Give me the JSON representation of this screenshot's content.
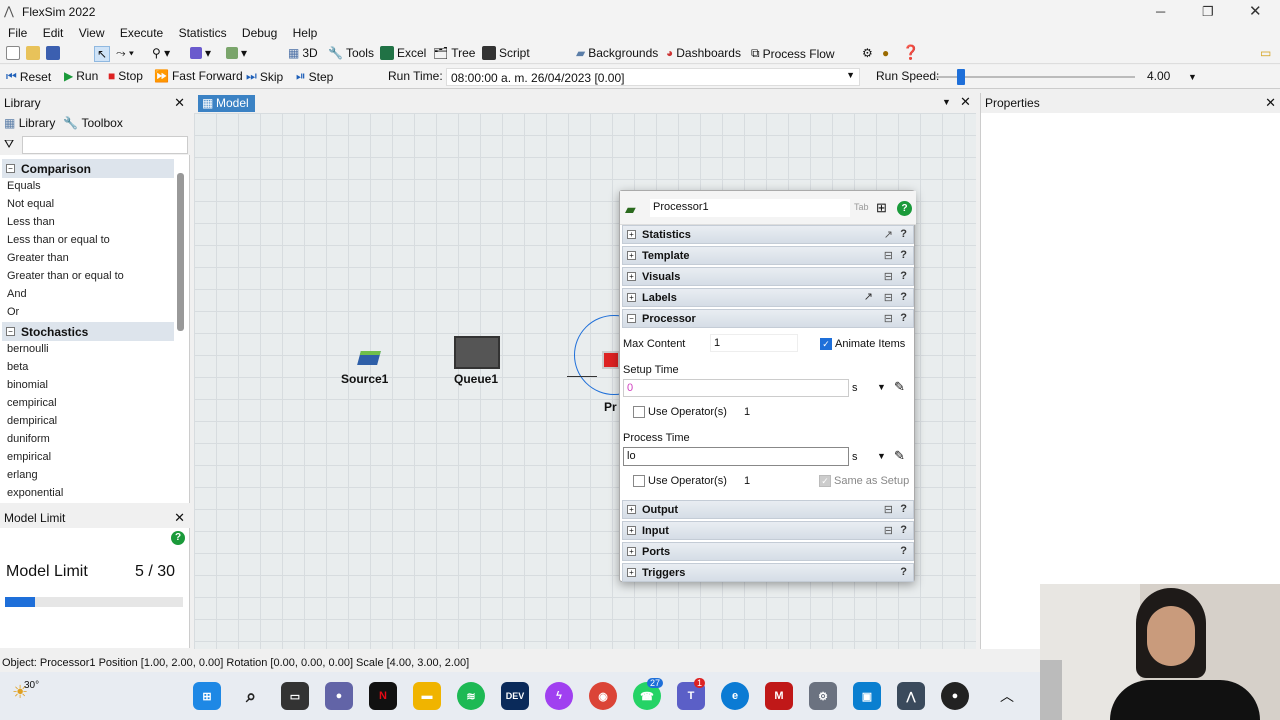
{
  "window": {
    "title": "FlexSim 2022"
  },
  "menu": [
    "File",
    "Edit",
    "View",
    "Execute",
    "Statistics",
    "Debug",
    "Help"
  ],
  "toolbar1": {
    "3d": "3D",
    "tools": "Tools",
    "excel": "Excel",
    "tree": "Tree",
    "script": "Script",
    "backgrounds": "Backgrounds",
    "dashboards": "Dashboards",
    "process_flow": "Process Flow"
  },
  "toolbar2": {
    "reset": "Reset",
    "run": "Run",
    "stop": "Stop",
    "fast_forward": "Fast Forward",
    "skip": "Skip",
    "step": "Step",
    "run_time_label": "Run Time:",
    "run_time_value": "08:00:00 a. m.  26/04/2023  [0.00]",
    "run_speed_label": "Run Speed:",
    "run_speed_value": "4.00"
  },
  "library": {
    "title": "Library",
    "tab_library": "Library",
    "tab_toolbox": "Toolbox",
    "sections": [
      {
        "name": "Comparison",
        "items": [
          "Equals",
          "Not equal",
          "Less than",
          "Less than or equal to",
          "Greater than",
          "Greater than or equal to",
          "And",
          "Or"
        ]
      },
      {
        "name": "Stochastics",
        "items": [
          "bernoulli",
          "beta",
          "binomial",
          "cempirical",
          "dempirical",
          "duniform",
          "empirical",
          "erlang",
          "exponential"
        ]
      }
    ]
  },
  "model_limit": {
    "title": "Model Limit",
    "label": "Model Limit",
    "value": "5 / 30",
    "progress": 0.1667
  },
  "viewport": {
    "tab": "Model",
    "objects": {
      "source": "Source1",
      "queue": "Queue1",
      "processor_partial": "Pr"
    }
  },
  "properties": {
    "title": "Properties"
  },
  "dialog": {
    "name": "Processor1",
    "tab_hint": "Tab",
    "sections": {
      "statistics": "Statistics",
      "template": "Template",
      "visuals": "Visuals",
      "labels": "Labels",
      "processor": "Processor",
      "output": "Output",
      "input": "Input",
      "ports": "Ports",
      "triggers": "Triggers"
    },
    "max_content_label": "Max Content",
    "max_content_value": "1",
    "animate_items": "Animate Items",
    "setup_time_label": "Setup Time",
    "setup_time_value": "0",
    "unit_s": "s",
    "use_operators": "Use Operator(s)",
    "operators_count": "1",
    "process_time_label": "Process Time",
    "process_time_value": "lo",
    "same_as_setup": "Same as Setup"
  },
  "status": {
    "text": "Object: Processor1  Position [1.00, 2.00, 0.00]  Rotation [0.00, 0.00, 0.00]  Scale [4.00, 3.00, 2.00]"
  },
  "taskbar": {
    "weather": "30°",
    "teams_badge": "27",
    "teams2_badge": "1"
  }
}
